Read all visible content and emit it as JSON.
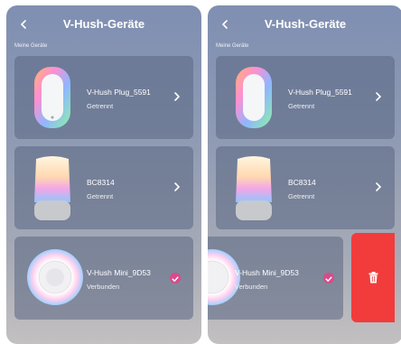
{
  "header": {
    "title": "V-Hush-Geräte",
    "back_icon": "chevron-left-icon"
  },
  "section_label": "Meine Geräte",
  "devices": [
    {
      "name": "V-Hush Plug_5591",
      "status": "Getrennt",
      "action_icon": "chevron-right-icon"
    },
    {
      "name": "BC8314",
      "status": "Getrennt",
      "action_icon": "chevron-right-icon"
    },
    {
      "name": "V-Hush Mini_9D53",
      "status": "Verbunden",
      "action_icon": "check-circle-icon"
    }
  ],
  "swipe_action": {
    "icon": "trash-icon"
  },
  "colors": {
    "check": "#d94a8c",
    "delete": "#f23b3b"
  }
}
